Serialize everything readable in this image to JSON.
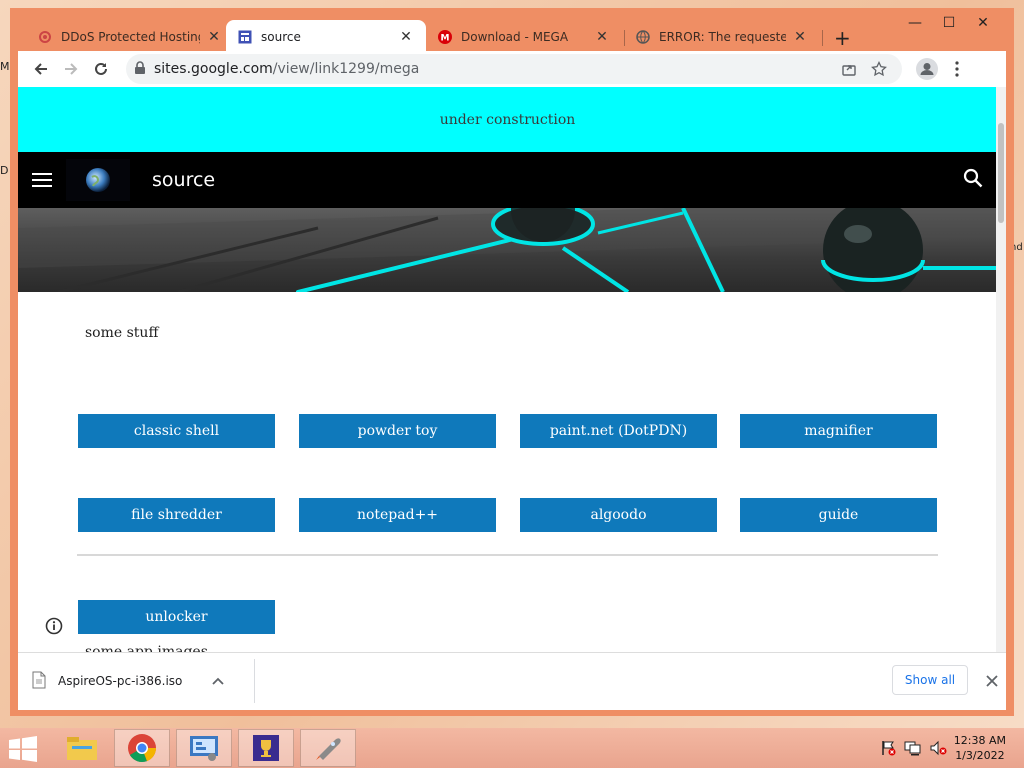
{
  "desktop": {
    "edge_labels": [
      "M",
      "D",
      "nd"
    ]
  },
  "browser": {
    "tabs": [
      {
        "title": "DDoS Protected Hosting",
        "icon": "ddos-icon",
        "active": false
      },
      {
        "title": "source",
        "icon": "google-sites-icon",
        "active": true
      },
      {
        "title": "Download - MEGA",
        "icon": "mega-icon",
        "active": false
      },
      {
        "title": "ERROR: The requested URL",
        "icon": "globe-icon",
        "active": false
      }
    ],
    "new_tab_label": "+",
    "window_controls": {
      "minimize": "—",
      "maximize": "☐",
      "close": "✕"
    },
    "address": {
      "host": "sites.google.com",
      "path": "/view/link1299/mega"
    }
  },
  "page": {
    "banner_text": "under construction",
    "site_title": "source",
    "section_heading": "some stuff",
    "buttons_row1": [
      "classic shell",
      "powder toy",
      "paint.net (DotPDN)",
      "magnifier"
    ],
    "buttons_row2": [
      "file shredder",
      "notepad++",
      "algoodo",
      "guide"
    ],
    "button_row3": "unlocker",
    "next_heading": "some app images"
  },
  "downloads": {
    "file_name": "AspireOS-pc-i386.iso",
    "show_all_label": "Show all"
  },
  "taskbar": {
    "apps": [
      "file-explorer-icon",
      "chrome-icon",
      "control-panel-icon",
      "trophy-icon",
      "rocket-icon"
    ],
    "clock_time": "12:38 AM",
    "clock_date": "1/3/2022"
  },
  "colors": {
    "banner": "#00ffff",
    "button": "#0f79bb",
    "window_frame": "#ef8e64"
  }
}
